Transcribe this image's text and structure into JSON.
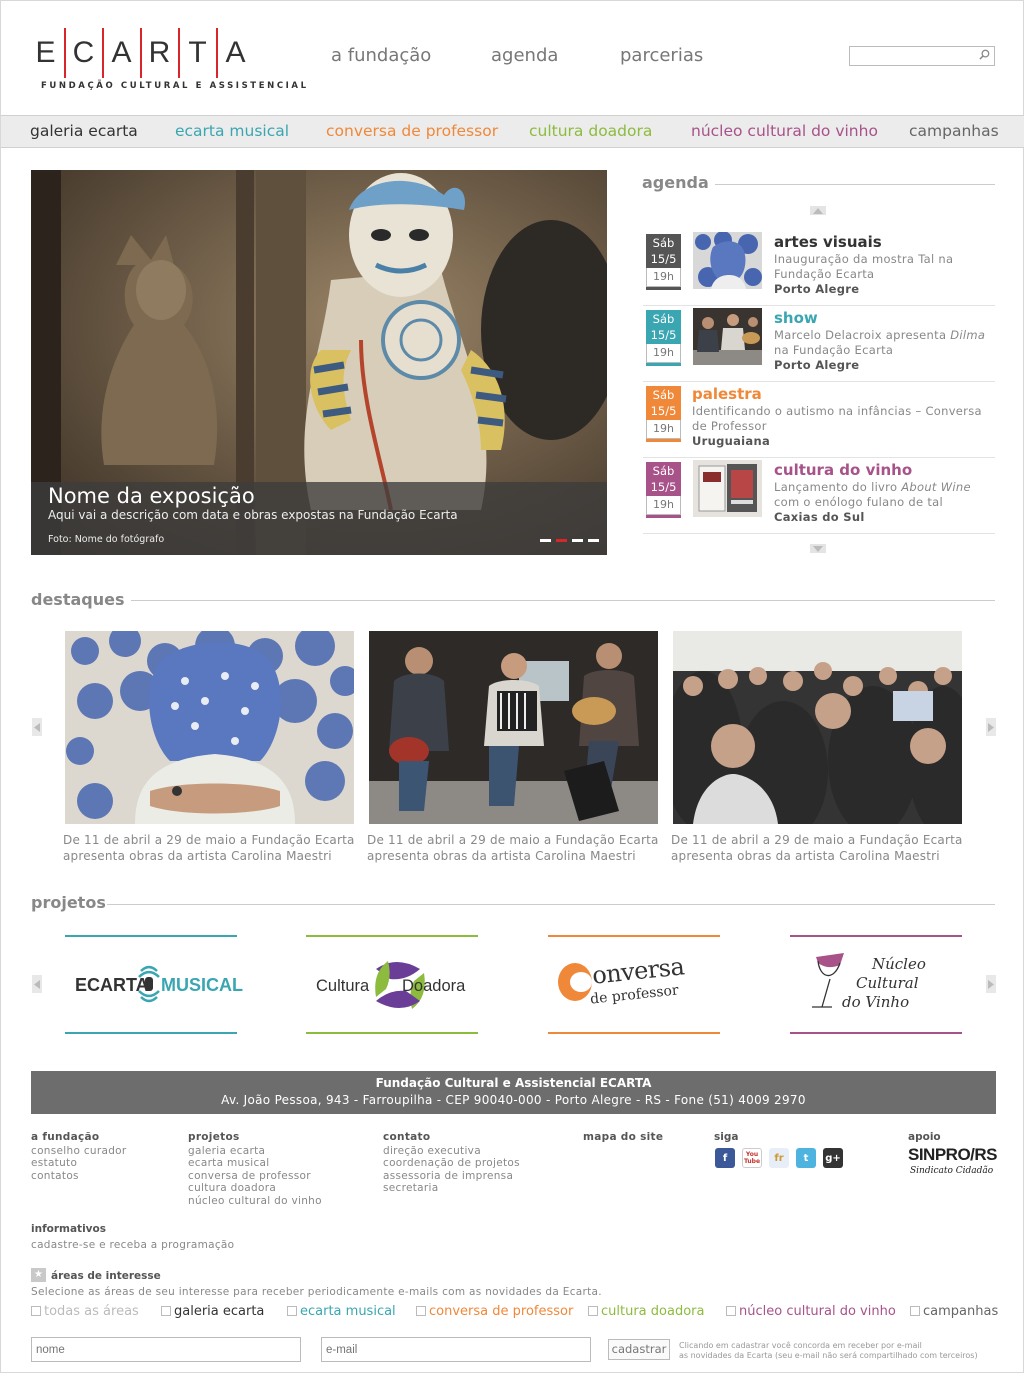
{
  "brand": {
    "letters": [
      "E",
      "C",
      "A",
      "R",
      "T",
      "A"
    ],
    "subtitle": "FUNDAÇÃO CULTURAL E ASSISTENCIAL",
    "accent": "#d9262b"
  },
  "top_nav": [
    "a fundação",
    "agenda",
    "parcerias"
  ],
  "search": {
    "placeholder": "",
    "icon": "search-icon"
  },
  "categories": [
    {
      "label": "galeria ecarta",
      "color": "#333333"
    },
    {
      "label": "ecarta musical",
      "color": "#3aa6b1"
    },
    {
      "label": "conversa de professor",
      "color": "#f0883a"
    },
    {
      "label": "cultura doadora",
      "color": "#8dbb3e"
    },
    {
      "label": "núcleo cultural do vinho",
      "color": "#a8528a"
    },
    {
      "label": "campanhas",
      "color": "#666666"
    }
  ],
  "hero": {
    "title": "Nome da exposição",
    "description": "Aqui vai a descrição com data e obras expostas na Fundação Ecarta",
    "photo_credit": "Foto: Nome do fotógrafo",
    "slides": 4,
    "active_slide": 2
  },
  "agenda": {
    "title": "agenda",
    "items": [
      {
        "day": "Sáb",
        "date": "15/5",
        "hour": "19h",
        "category": "artes visuais",
        "cat_color": "#333333",
        "date_color": "#555555",
        "desc": "Inauguração da mostra Tal na Fundação Ecarta",
        "desc_before_italic": "",
        "italic": "",
        "desc_after_italic": "",
        "city": "Porto Alegre",
        "thumb": true
      },
      {
        "day": "Sáb",
        "date": "15/5",
        "hour": "19h",
        "category": "show",
        "cat_color": "#3aa6b1",
        "date_color": "#3aa6b1",
        "desc_before_italic": "Marcelo Delacroix apresenta ",
        "italic": "Dilma",
        "desc_after_italic": " na Fundação Ecarta",
        "city": "Porto Alegre",
        "thumb": true
      },
      {
        "day": "Sáb",
        "date": "15/5",
        "hour": "19h",
        "category": "palestra",
        "cat_color": "#f0883a",
        "date_color": "#f0883a",
        "desc": "Identificando o autismo na infâncias – Conversa de Professor",
        "city": "Uruguaiana",
        "thumb": false
      },
      {
        "day": "Sáb",
        "date": "15/5",
        "hour": "19h",
        "category": "cultura do vinho",
        "cat_color": "#a8528a",
        "date_color": "#a8528a",
        "desc_before_italic": "Lançamento do livro ",
        "italic": "About Wine",
        "desc_after_italic": " com o enólogo fulano de tal",
        "city": "Caxias do Sul",
        "thumb": true
      }
    ]
  },
  "destaques": {
    "title": "destaques",
    "items": [
      {
        "caption": "De 11 de abril a 29 de maio a Fundação Ecarta apresenta obras da artista Carolina Maestri"
      },
      {
        "caption": "De 11 de abril a 29 de maio a Fundação Ecarta apresenta obras da artista Carolina Maestri"
      },
      {
        "caption": "De 11 de abril a 29 de maio a Fundação Ecarta apresenta obras da artista Carolina Maestri"
      }
    ]
  },
  "projetos": {
    "title": "projetos",
    "items": [
      {
        "name": "ecarta-musical",
        "color": "#3aa6b1",
        "logo_a": "ECARTA",
        "logo_b": "MUSICAL"
      },
      {
        "name": "cultura-doadora",
        "color": "#8dbb3e",
        "logo_a": "Cultura",
        "logo_b": "Doadora"
      },
      {
        "name": "conversa-de-professor",
        "color": "#f0883a",
        "logo_a": "onversa",
        "logo_b": "de professor"
      },
      {
        "name": "nucleo-cultural-do-vinho",
        "color": "#a8528a",
        "logo_a": "Núcleo",
        "logo_b": "Cultural",
        "logo_c": "do Vinho"
      }
    ]
  },
  "footer": {
    "org": "Fundação Cultural e Assistencial ECARTA",
    "address": "Av. João Pessoa, 943 - Farroupilha - CEP 90040-000 - Porto Alegre - RS - Fone (51) 4009 2970",
    "cols": [
      {
        "title": "a fundação",
        "links": [
          "conselho curador",
          "estatuto",
          "contatos"
        ]
      },
      {
        "title": "projetos",
        "links": [
          "galeria ecarta",
          "ecarta musical",
          "conversa de professor",
          "cultura doadora",
          "núcleo cultural do vinho"
        ]
      },
      {
        "title": "contato",
        "links": [
          "direção executiva",
          "coordenação de projetos",
          "assessoria de imprensa",
          "secretaria"
        ]
      },
      {
        "title": "mapa do site",
        "links": []
      }
    ],
    "siga": "siga",
    "social": [
      "f",
      "You Tube",
      "fr",
      "t",
      "g+"
    ],
    "apoio": "apoio",
    "apoio_logo": "SINPRO/RS",
    "apoio_tagline": "Sindicato Cidadão",
    "informativos_title": "informativos",
    "informativos_text": "cadastre-se e receba a programação",
    "areas_title": "áreas de interesse",
    "areas_text": "Selecione as áreas de seu interesse para receber periodicamente e-mails com as novidades da Ecarta.",
    "areas": [
      {
        "label": "todas as áreas",
        "color": "#bbbbbb"
      },
      {
        "label": "galeria ecarta",
        "color": "#333333"
      },
      {
        "label": "ecarta musical",
        "color": "#3aa6b1"
      },
      {
        "label": "conversa de professor",
        "color": "#f0883a"
      },
      {
        "label": "cultura doadora",
        "color": "#8dbb3e"
      },
      {
        "label": "núcleo cultural do vinho",
        "color": "#a8528a"
      },
      {
        "label": "campanhas",
        "color": "#666666"
      }
    ],
    "name_placeholder": "nome",
    "email_placeholder": "e-mail",
    "submit": "cadastrar",
    "disclaimer_1": "Clicando em cadastrar você concorda em receber por e-mail",
    "disclaimer_2": "as novidades da Ecarta (seu e-mail não será compartilhado com terceiros)"
  }
}
